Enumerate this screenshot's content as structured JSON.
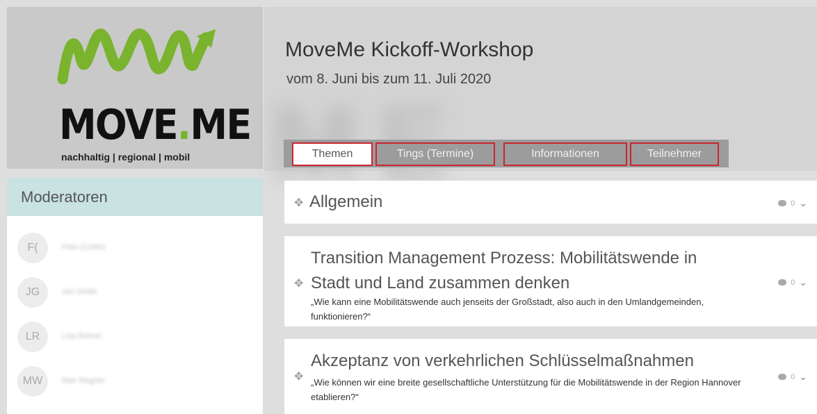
{
  "brand": {
    "logo_word_a": "MOVE",
    "logo_dot": ".",
    "logo_word_b": "ME",
    "tagline": "nachhaltig | regional | mobil",
    "accent_green": "#7ab32e"
  },
  "header": {
    "title": "MoveMe Kickoff-Workshop",
    "subtitle": "vom 8. Juni bis zum 11. Juli 2020"
  },
  "tabs": [
    {
      "label": "Themen",
      "active": true
    },
    {
      "label": "Tings (Termine)",
      "active": false
    },
    {
      "label": "Informationen",
      "active": false
    },
    {
      "label": "Teilnehmer",
      "active": false
    }
  ],
  "sidebar": {
    "title": "Moderatoren",
    "moderators": [
      {
        "initials": "F(",
        "name": "Felix (CoMo)"
      },
      {
        "initials": "JG",
        "name": "Jan Gödel"
      },
      {
        "initials": "LR",
        "name": "Lisa Rohrer"
      },
      {
        "initials": "MW",
        "name": "Max Wagner"
      }
    ]
  },
  "topics": [
    {
      "icon": "move-icon",
      "title": "Allgemein",
      "description": "",
      "comments": "0"
    },
    {
      "icon": "move-icon",
      "title_line1": "Transition Management Prozess: Mobilitätswende in",
      "title_line2": "Stadt und Land zusammen denken",
      "description": "„Wie kann eine Mobilitätswende auch jenseits der Großstadt, also auch in den Umlandgemeinden, funktionieren?“",
      "comments": "0"
    },
    {
      "icon": "move-icon",
      "title": "Akzeptanz von verkehrlichen Schlüsselmaßnahmen",
      "description": "„Wie können wir eine breite gesellschaftliche Unterstützung für die Mobilitätswende in der Region Hannover etablieren?“",
      "comments": "0"
    }
  ],
  "icons": {
    "move": "✥",
    "chevron": "chevron-down-icon",
    "comment": "comment-icon"
  }
}
